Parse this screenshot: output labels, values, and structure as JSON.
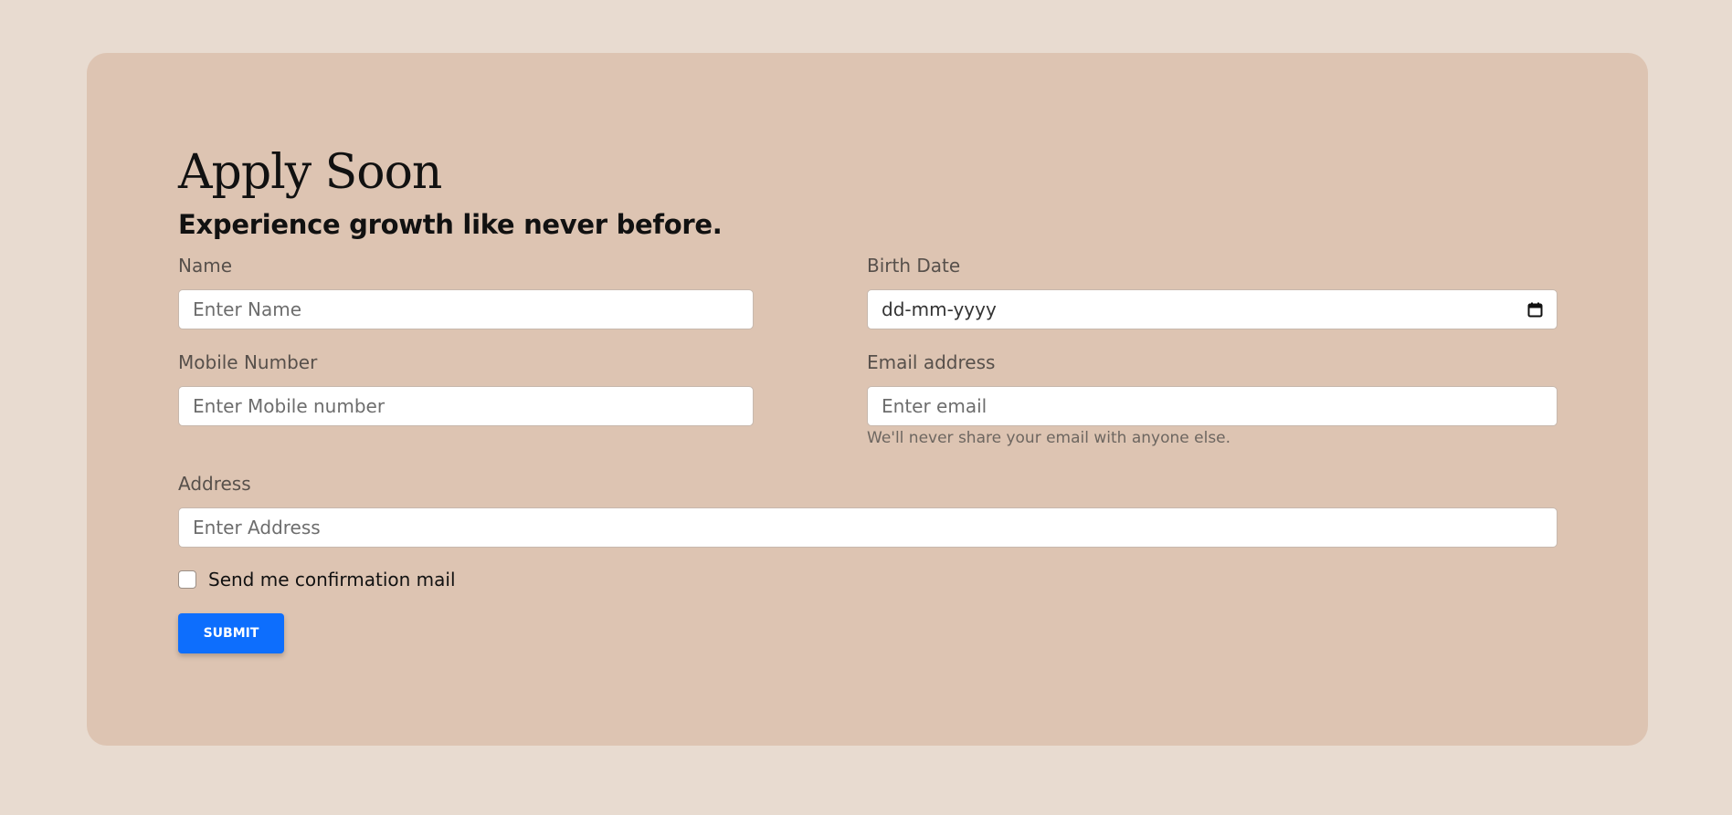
{
  "form": {
    "title": "Apply Soon",
    "subtitle": "Experience growth like never before.",
    "fields": {
      "name": {
        "label": "Name",
        "placeholder": "Enter Name",
        "value": ""
      },
      "birth_date": {
        "label": "Birth Date",
        "placeholder": "dd-mm-yyyy",
        "value": ""
      },
      "mobile": {
        "label": "Mobile Number",
        "placeholder": "Enter Mobile number",
        "value": ""
      },
      "email": {
        "label": "Email address",
        "placeholder": "Enter email",
        "value": "",
        "help_text": "We'll never share your email with anyone else."
      },
      "address": {
        "label": "Address",
        "placeholder": "Enter Address",
        "value": ""
      }
    },
    "confirmation_checkbox": {
      "label": "Send me confirmation mail",
      "checked": false
    },
    "submit_label": "SUBMIT"
  },
  "icons": {
    "calendar": "calendar-icon"
  },
  "colors": {
    "page_background": "#e8dbd0",
    "card_background": "#ddc4b2",
    "submit_button": "#0d6efd",
    "label_text": "#57504b",
    "help_text": "#6d6660"
  }
}
